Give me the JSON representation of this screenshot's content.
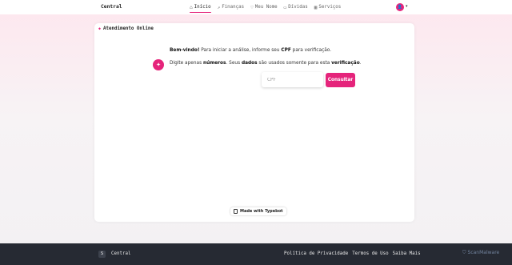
{
  "header": {
    "brand": "Central",
    "nav": [
      {
        "label": "Início",
        "icon": "home-icon",
        "glyph": "⌂",
        "active": true
      },
      {
        "label": "Finanças",
        "icon": "trend-icon",
        "glyph": "↗",
        "active": false
      },
      {
        "label": "Meu Nome",
        "icon": "heart-icon",
        "glyph": "♡",
        "active": false
      },
      {
        "label": "Dívidas",
        "icon": "wallet-icon",
        "glyph": "▭",
        "active": false
      },
      {
        "label": "Serviços",
        "icon": "grid-icon",
        "glyph": "▦",
        "active": false
      }
    ],
    "avatar_glyph": "👤",
    "caret_glyph": "▾"
  },
  "chat": {
    "title": "Atendimento Online",
    "bot_glyph": "✦",
    "message1": {
      "bold1": "Bem-vindo!",
      "text1": " Para iniciar a análise, informe seu ",
      "bold2": "CPF",
      "text2": " para verificação."
    },
    "message2": {
      "text1": "Digite apenas ",
      "bold1": "números",
      "text2": ". Seus ",
      "bold2": "dados",
      "text3": " são usados somente para esta ",
      "bold3": "verificação",
      "text4": "."
    },
    "input_placeholder": "CPF",
    "button_label": "Consultar",
    "badge": "Made with Typebot"
  },
  "footer": {
    "logo_letter": "S",
    "brand": "Central",
    "links": [
      "Política de Privacidade",
      "Termos de Uso",
      "Saiba Mais"
    ]
  },
  "watermark": "ScanMalware",
  "colors": {
    "accent": "#e5247b",
    "footer_bg": "#262a33"
  }
}
